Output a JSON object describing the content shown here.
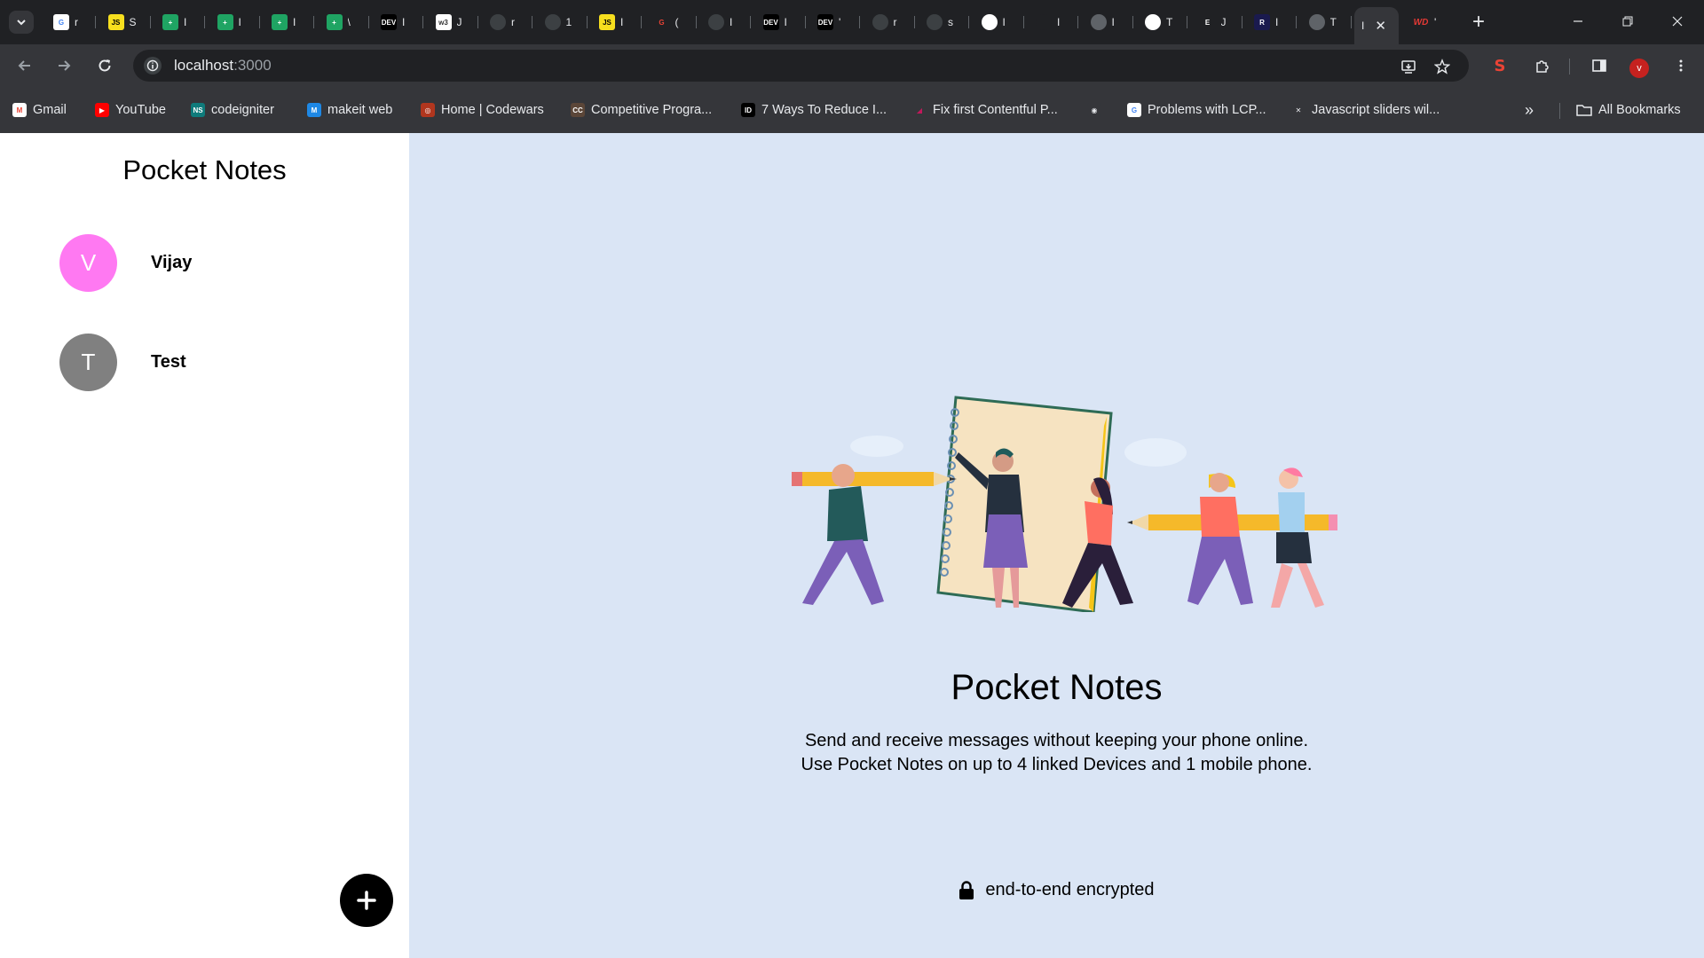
{
  "browser": {
    "url_host": "localhost",
    "url_port": ":3000",
    "profile_initial": "v",
    "tabs": [
      {
        "initial": "r",
        "badge": "G",
        "color": "#ffffff",
        "fg": "#4285f4"
      },
      {
        "initial": "S",
        "badge": "JS",
        "color": "#f7df1e",
        "fg": "#000000"
      },
      {
        "initial": "I",
        "badge": "+",
        "color": "#1fa463",
        "fg": "#ffffff"
      },
      {
        "initial": "I",
        "badge": "+",
        "color": "#1fa463",
        "fg": "#ffffff"
      },
      {
        "initial": "I",
        "badge": "+",
        "color": "#1fa463",
        "fg": "#ffffff"
      },
      {
        "initial": "\\",
        "badge": "+",
        "color": "#1fa463",
        "fg": "#ffffff"
      },
      {
        "initial": "I",
        "badge": "DEV",
        "color": "#000000",
        "fg": "#ffffff"
      },
      {
        "initial": "J",
        "badge": "w3",
        "color": "#ffffff",
        "fg": "#333333"
      },
      {
        "initial": "r",
        "badge": "",
        "color": "#3c4043",
        "fg": "#ffffff"
      },
      {
        "initial": "1",
        "badge": "",
        "color": "#3c4043",
        "fg": "#ffffff"
      },
      {
        "initial": "I",
        "badge": "JS",
        "color": "#f7df1e",
        "fg": "#000000"
      },
      {
        "initial": "(",
        "badge": "G",
        "color": "#202124",
        "fg": "#ea4335"
      },
      {
        "initial": "I",
        "badge": "",
        "color": "#3c4043",
        "fg": "#ffffff"
      },
      {
        "initial": "I",
        "badge": "DEV",
        "color": "#000000",
        "fg": "#ffffff"
      },
      {
        "initial": "'",
        "badge": "DEV",
        "color": "#000000",
        "fg": "#ffffff"
      },
      {
        "initial": "r",
        "badge": "",
        "color": "#3c4043",
        "fg": "#ffffff"
      },
      {
        "initial": "s",
        "badge": "",
        "color": "#3c4043",
        "fg": "#ffffff"
      },
      {
        "initial": "I",
        "badge": "",
        "color": "#ffffff",
        "fg": "#000000"
      },
      {
        "initial": "I",
        "badge": "",
        "color": "#202124",
        "fg": "#ffffff"
      },
      {
        "initial": "I",
        "badge": "",
        "color": "#5f6368",
        "fg": "#ffffff"
      },
      {
        "initial": "T",
        "badge": "",
        "color": "#ffffff",
        "fg": "#000000"
      },
      {
        "initial": "J",
        "badge": "E",
        "color": "#202124",
        "fg": "#ffffff"
      },
      {
        "initial": "I",
        "badge": "R",
        "color": "#1a1a4e",
        "fg": "#ffffff"
      },
      {
        "initial": "T",
        "badge": "",
        "color": "#5f6368",
        "fg": "#ffffff"
      }
    ],
    "active_tab": {
      "initial": "I"
    },
    "extra_tab": {
      "initial": "'",
      "badge": "WD",
      "fg": "#e53935"
    },
    "bookmarks": [
      {
        "label": "Gmail",
        "icon": "gmail-icon",
        "badge": "M",
        "color": "#ffffff",
        "fg": "#ea4335"
      },
      {
        "label": "YouTube",
        "icon": "youtube-icon",
        "badge": "▶",
        "color": "#ff0000",
        "fg": "#ffffff"
      },
      {
        "label": "codeigniter",
        "icon": "codeigniter-icon",
        "badge": "NS",
        "color": "#0f7b7b",
        "fg": "#ffffff"
      },
      {
        "label": "makeit web",
        "icon": "makeit-icon",
        "badge": "M",
        "color": "#1e88e5",
        "fg": "#ffffff"
      },
      {
        "label": "Home | Codewars",
        "icon": "codewars-icon",
        "badge": "◎",
        "color": "#b1361e",
        "fg": "#ffffff"
      },
      {
        "label": "Competitive Progra...",
        "icon": "cc-icon",
        "badge": "CC",
        "color": "#5b4638",
        "fg": "#ffffff"
      },
      {
        "label": "7 Ways To Reduce I...",
        "icon": "id-icon",
        "badge": "ID",
        "color": "#000000",
        "fg": "#ffffff"
      },
      {
        "label": "Fix first Contentful P...",
        "icon": "fcp-icon",
        "badge": "◢",
        "color": "#35363a",
        "fg": "#c2185b"
      },
      {
        "label": "",
        "icon": "globe-icon",
        "badge": "◉",
        "color": "#35363a",
        "fg": "#e8eaed"
      },
      {
        "label": "Problems with LCP...",
        "icon": "google-icon",
        "badge": "G",
        "color": "#ffffff",
        "fg": "#4285f4"
      },
      {
        "label": "Javascript sliders wil...",
        "icon": "xmark-circle-icon",
        "badge": "✕",
        "color": "#35363a",
        "fg": "#e8eaed"
      }
    ],
    "all_bookmarks_label": "All Bookmarks"
  },
  "sidebar": {
    "title": "Pocket Notes",
    "groups": [
      {
        "initial": "V",
        "name": "Vijay",
        "color": "#ff79f2"
      },
      {
        "initial": "T",
        "name": "Test",
        "color": "#808080"
      }
    ]
  },
  "main": {
    "title": "Pocket Notes",
    "desc_line1": "Send and receive messages without keeping your phone online.",
    "desc_line2": "Use Pocket Notes on up to 4 linked Devices and 1 mobile phone.",
    "encrypted_label": "end-to-end encrypted"
  },
  "colors": {
    "sidebar_bg": "#ffffff",
    "main_bg": "#dae5f5",
    "fab_bg": "#000000"
  }
}
